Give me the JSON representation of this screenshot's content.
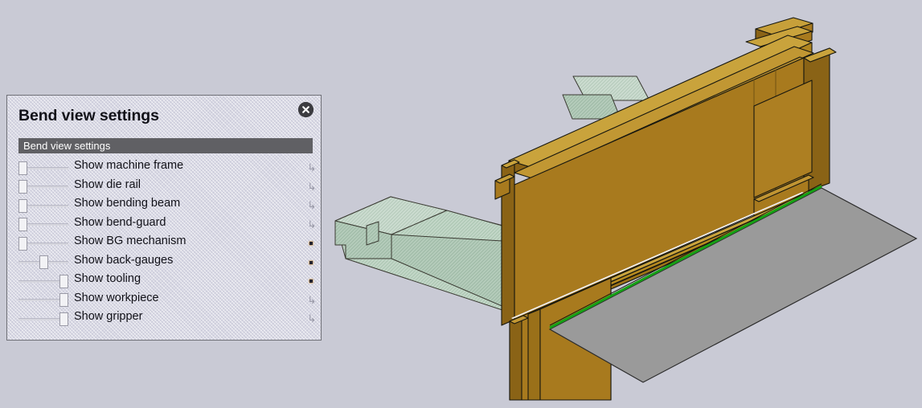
{
  "app": {
    "background_color": "#c9cad5"
  },
  "dialog": {
    "title": "Bend view settings",
    "close_icon": "close-circle-icon",
    "group_header": "Bend view settings",
    "rows": [
      {
        "label": "Show machine frame",
        "slider_value": 0,
        "marker": "↳",
        "marker_kind": "arrow"
      },
      {
        "label": "Show die rail",
        "slider_value": 0,
        "marker": "↳",
        "marker_kind": "arrow"
      },
      {
        "label": "Show bending beam",
        "slider_value": 0,
        "marker": "↳",
        "marker_kind": "arrow"
      },
      {
        "label": "Show bend-guard",
        "slider_value": 0,
        "marker": "↳",
        "marker_kind": "arrow"
      },
      {
        "label": "Show BG mechanism",
        "slider_value": 0,
        "marker": "•",
        "marker_kind": "dot"
      },
      {
        "label": "Show back-gauges",
        "slider_value": 50,
        "marker": "•",
        "marker_kind": "dot"
      },
      {
        "label": "Show tooling",
        "slider_value": 100,
        "marker": "•",
        "marker_kind": "dot"
      },
      {
        "label": "Show workpiece",
        "slider_value": 100,
        "marker": "↳",
        "marker_kind": "arrow"
      },
      {
        "label": "Show gripper",
        "slider_value": 100,
        "marker": "↳",
        "marker_kind": "arrow"
      }
    ]
  },
  "scene": {
    "description": "Isometric 3D press-brake bend view",
    "colors": {
      "machine_gold": "#a87a1e",
      "machine_gold_light": "#c39a34",
      "machine_gold_dark": "#8a6316",
      "backgauge_green": "#bcd3c2",
      "workpiece_gray": "#9a9a9a",
      "bend_line_green": "#15a015",
      "edge": "#17170f"
    }
  }
}
